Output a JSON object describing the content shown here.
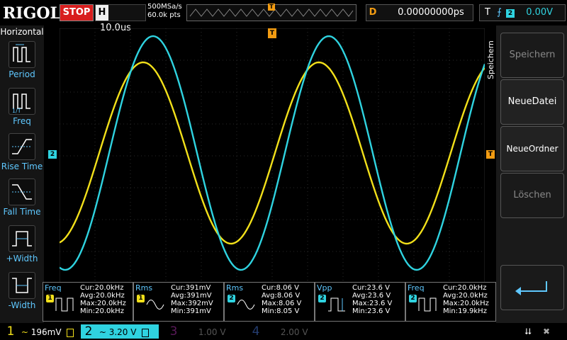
{
  "header": {
    "brand": "RIGOL",
    "run_state": "STOP",
    "horizontal_label": "H",
    "timebase": "10.0us",
    "sample_rate": "500MSa/s",
    "points": "60.0k pts",
    "trigger_marker": "T",
    "delay_label": "D",
    "delay_value": "0.00000000ps",
    "trigger_label": "T",
    "trigger_source": "2",
    "trigger_level": "0.00V"
  },
  "left_menu": {
    "title": "Horizontal",
    "items": [
      {
        "label": "Period"
      },
      {
        "label": "Freq"
      },
      {
        "label": "Rise Time"
      },
      {
        "label": "Fall Time"
      },
      {
        "label": "+Width"
      },
      {
        "label": "-Width"
      }
    ]
  },
  "right_menu": {
    "title": "Speichern",
    "buttons": [
      {
        "label": "Speichern"
      },
      {
        "label": "NeueDatei"
      },
      {
        "label": "NeueOrdner"
      },
      {
        "label": "Löschen"
      }
    ]
  },
  "markers": {
    "ch2_ref": "2",
    "trigger_level": "T",
    "trigger_top": "T"
  },
  "measurements": [
    {
      "name": "Freq",
      "channel": "1",
      "cur": "Cur:20.0kHz",
      "avg": "Avg:20.0kHz",
      "max": "Max:20.0kHz",
      "min": "Min:20.0kHz"
    },
    {
      "name": "Rms",
      "channel": "1",
      "cur": "Cur:391mV",
      "avg": "Avg:391mV",
      "max": "Max:392mV",
      "min": "Min:391mV"
    },
    {
      "name": "Rms",
      "channel": "2",
      "cur": "Cur:8.06 V",
      "avg": "Avg:8.06 V",
      "max": "Max:8.06 V",
      "min": "Min:8.05 V"
    },
    {
      "name": "Vpp",
      "channel": "2",
      "cur": "Cur:23.6 V",
      "avg": "Avg:23.6 V",
      "max": "Max:23.6 V",
      "min": "Min:23.6 V"
    },
    {
      "name": "Freq",
      "channel": "2",
      "cur": "Cur:20.0kHz",
      "avg": "Avg:20.0kHz",
      "max": "Max:20.0kHz",
      "min": "Min:19.9kHz"
    }
  ],
  "channels": [
    {
      "num": "1",
      "scale": "196mV",
      "coupling": "~",
      "color": "#f2e01a"
    },
    {
      "num": "2",
      "scale": "3.20 V",
      "coupling": "~",
      "color": "#2fd3e0"
    },
    {
      "num": "3",
      "scale": "1.00 V",
      "coupling": "",
      "color": "#c000c0"
    },
    {
      "num": "4",
      "scale": "2.00 V",
      "coupling": "",
      "color": "#3b6fd8"
    }
  ],
  "colors": {
    "ch1": "#f2e01a",
    "ch2": "#2fd3e0",
    "accent_blue": "#5fc8ff",
    "trigger_orange": "#f39c12",
    "stop_red": "#d81e1e"
  },
  "waveforms": {
    "ch1": {
      "frequency_khz": 20.0,
      "rms_mv": 391
    },
    "ch2": {
      "frequency_khz": 20.0,
      "vpp_v": 23.6
    }
  }
}
